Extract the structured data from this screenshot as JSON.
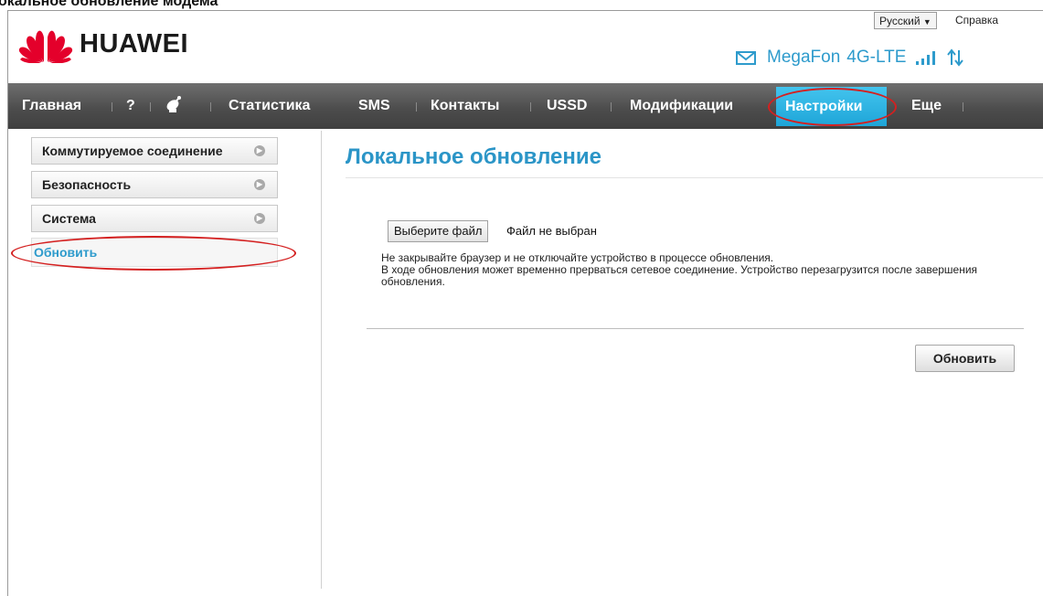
{
  "caption": "окальное обновление модема",
  "header": {
    "brand": "HUAWEI",
    "language": "Русский",
    "language_arrow": "▼",
    "help": "Справка",
    "operator": "MegaFon",
    "network": "4G-LTE",
    "icons": [
      "huawei-logo",
      "mail-icon",
      "signal-icon",
      "transfer-arrows-icon"
    ]
  },
  "nav": {
    "items": [
      {
        "label": "Главная"
      },
      {
        "label": "?"
      },
      {
        "label": "",
        "icon": "satellite-icon"
      },
      {
        "label": "Статистика"
      },
      {
        "label": "SMS"
      },
      {
        "label": "Контакты"
      },
      {
        "label": "USSD"
      },
      {
        "label": "Модификации"
      },
      {
        "label": "Настройки",
        "active": true
      },
      {
        "label": "Еще"
      }
    ]
  },
  "sidebar": {
    "items": [
      {
        "label": "Коммутируемое соединение"
      },
      {
        "label": "Безопасность"
      },
      {
        "label": "Система"
      },
      {
        "label": "Обновить",
        "active": true
      }
    ]
  },
  "main": {
    "title": "Локальное обновление",
    "file_button": "Выберите файл",
    "file_status": "Файл не выбран",
    "notice_lines": [
      "Не закрывайте браузер и не отключайте устройство в процессе обновления.",
      "В ходе обновления может временно прерваться сетевое соединение. Устройство перезагрузится после завершения обновления."
    ],
    "update_button": "Обновить"
  },
  "colors": {
    "accent": "#2e9bcc",
    "nav_bg": "#4d4d4d",
    "nav_active": "#2fb6e6",
    "annotation": "#d42020"
  }
}
